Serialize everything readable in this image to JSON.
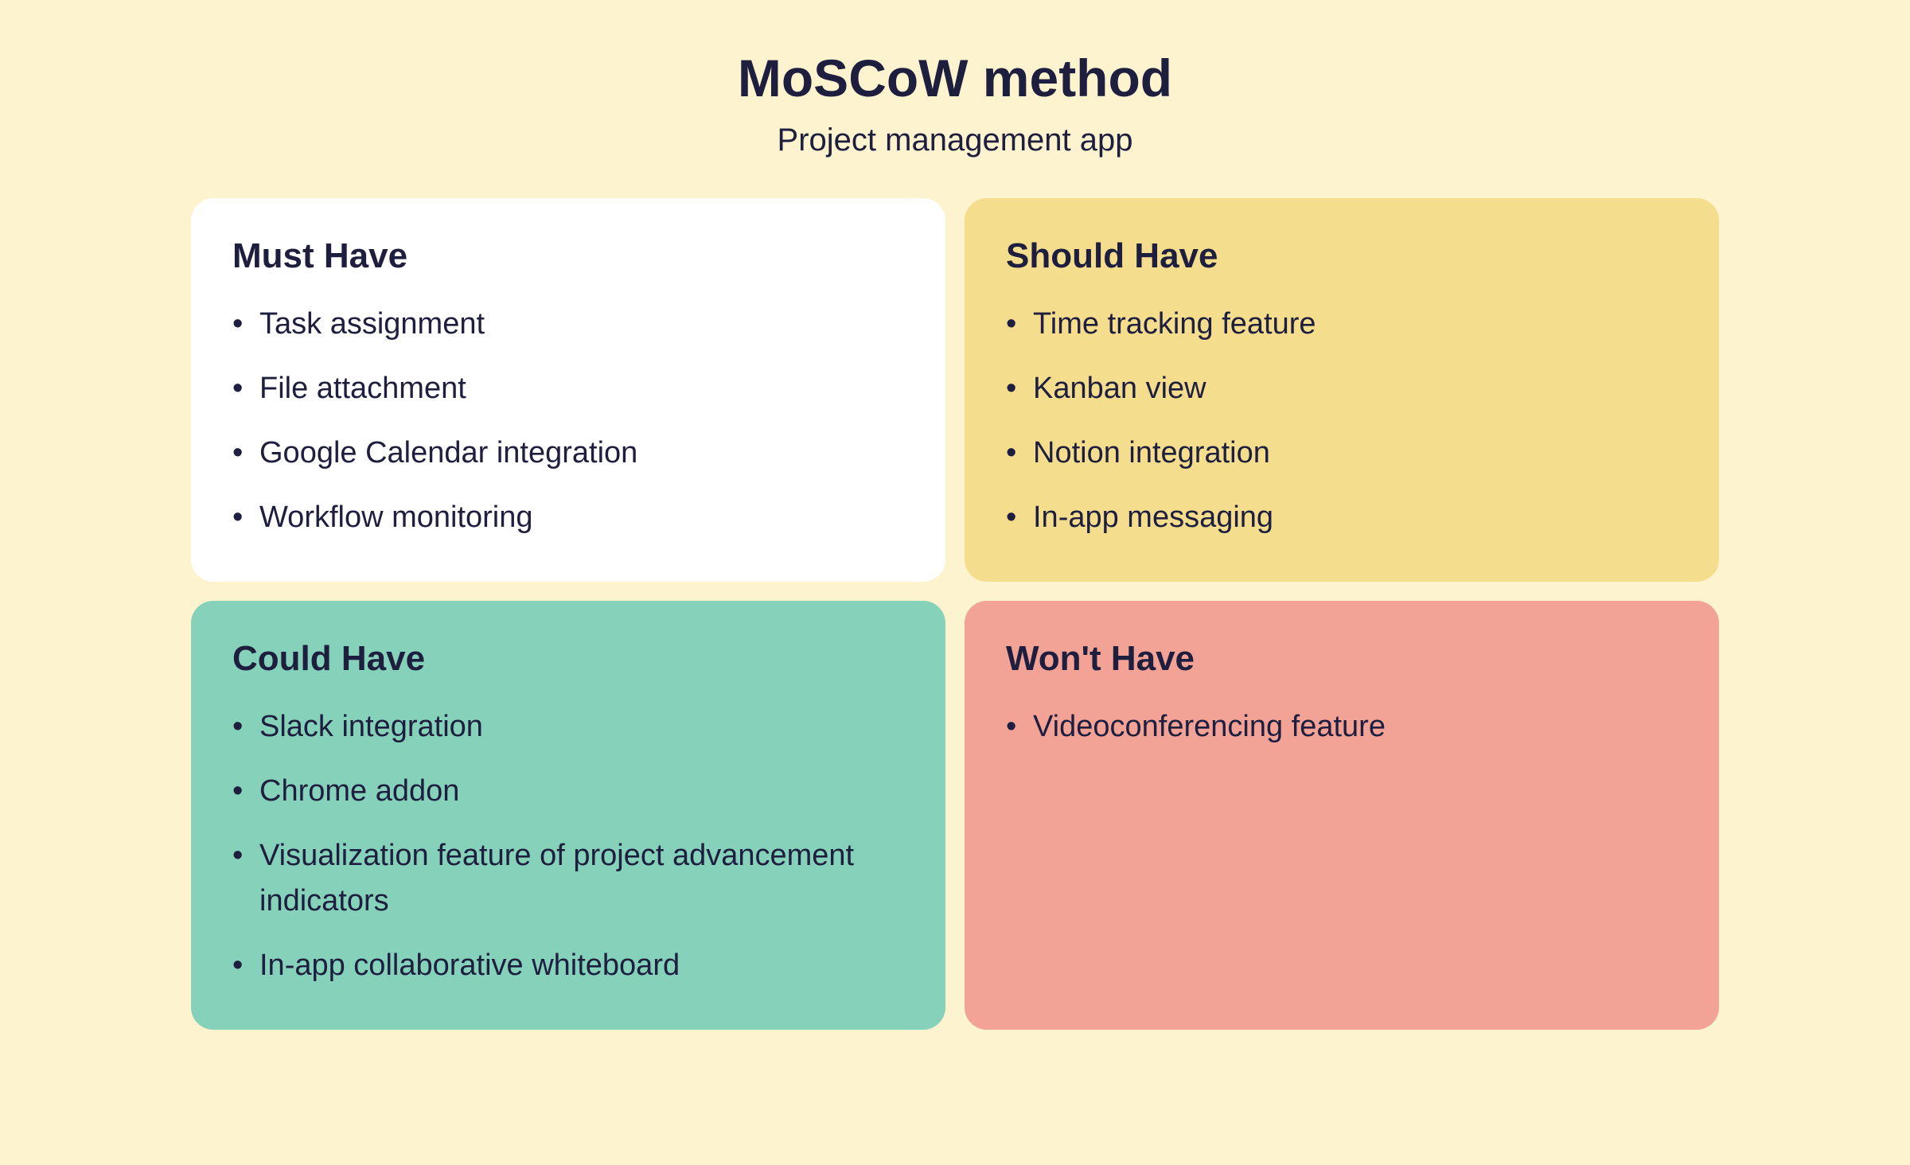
{
  "header": {
    "title": "MoSCoW method",
    "subtitle": "Project management app"
  },
  "cards": {
    "must": {
      "title": "Must Have",
      "items": [
        "Task assignment",
        "File attachment",
        "Google Calendar integration",
        "Workflow monitoring"
      ]
    },
    "should": {
      "title": "Should Have",
      "items": [
        "Time tracking feature",
        "Kanban view",
        "Notion integration",
        "In-app messaging"
      ]
    },
    "could": {
      "title": "Could Have",
      "items": [
        "Slack integration",
        "Chrome addon",
        "Visualization feature of project advancement indicators",
        "In-app collaborative whiteboard"
      ]
    },
    "wont": {
      "title": "Won't Have",
      "items": [
        "Videoconferencing feature"
      ]
    }
  },
  "colors": {
    "background": "#fdf3cf",
    "text": "#1e1e3f",
    "must_bg": "#ffffff",
    "should_bg": "#f5dd8e",
    "could_bg": "#85d1b9",
    "wont_bg": "#f3a296"
  }
}
